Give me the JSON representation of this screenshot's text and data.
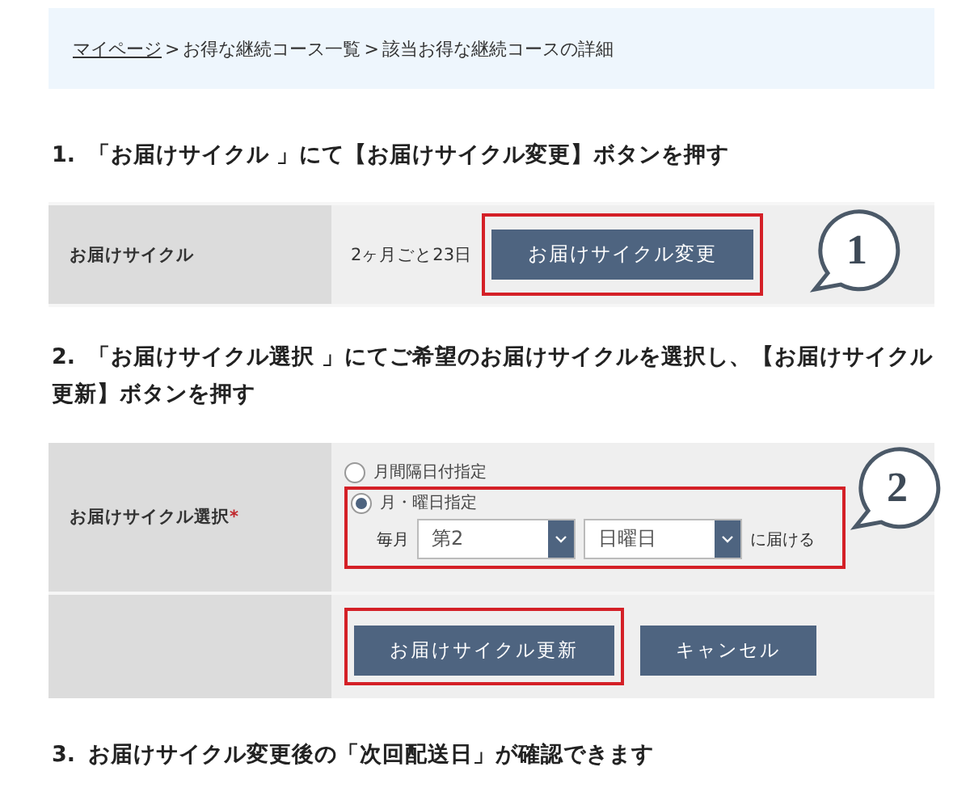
{
  "breadcrumb": [
    {
      "kind": "link",
      "label": "マイページ"
    },
    {
      "kind": "separator",
      "label": ">"
    },
    {
      "kind": "text",
      "label": "お得な継続コース一覧"
    },
    {
      "kind": "separator",
      "label": ">"
    },
    {
      "kind": "text",
      "label": "該当お得な継続コースの詳細"
    }
  ],
  "step_1": {
    "number": "1.",
    "text": "「お届けサイクル 」にて【お届けサイクル変更】ボタンを押す"
  },
  "cycle_panel": {
    "label": "お届けサイクル",
    "value": "2ヶ月ごと23日",
    "button": {
      "label": "お届けサイクル変更",
      "highlighted": true
    },
    "callout": "1"
  },
  "step_2": {
    "number": "2.",
    "text": "「お届けサイクル選択 」にてご希望のお届けサイクルを選択し、【お届けサイクル更新】ボタンを押す"
  },
  "select_panel": {
    "label": "お届けサイクル選択",
    "required_mark": "*",
    "options": [
      {
        "label": "月間隔日付指定",
        "selected": false
      },
      {
        "label": "月・曜日指定",
        "selected": true
      }
    ],
    "prefix": "毎月",
    "selects": [
      {
        "value": "第2"
      },
      {
        "value": "日曜日"
      }
    ],
    "suffix": "に届ける",
    "selection_highlighted": true,
    "callout": "2",
    "buttons": [
      {
        "label": "お届けサイクル更新",
        "highlighted": true
      },
      {
        "label": "キャンセル",
        "highlighted": false
      }
    ]
  },
  "step_3": {
    "number": "3.",
    "text": "お届けサイクル変更後の「次回配送日」が確認できます"
  }
}
